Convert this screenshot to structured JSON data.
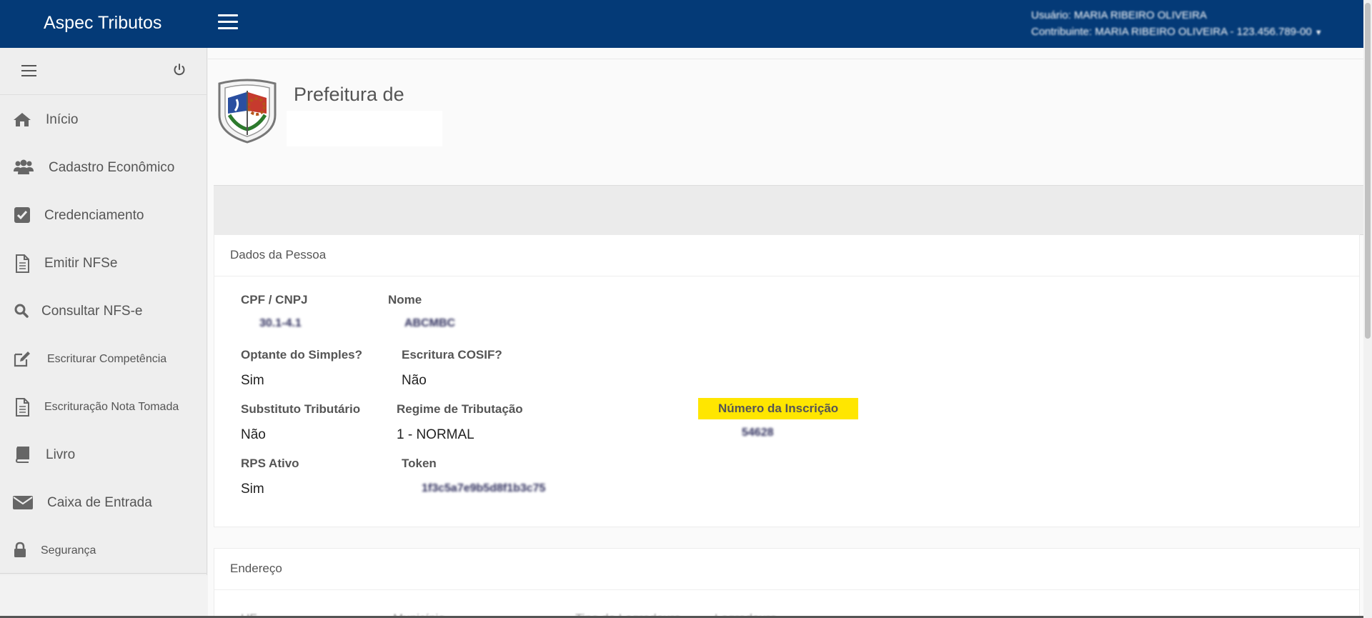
{
  "header": {
    "brand": "Aspec Tributos",
    "user_line1": "Usuário: MARIA RIBEIRO OLIVEIRA",
    "user_line2": "Contribuinte: MARIA RIBEIRO OLIVEIRA - 123.456.789-00"
  },
  "sidebar": {
    "items": [
      {
        "label": "Início",
        "icon": "home-icon"
      },
      {
        "label": "Cadastro Econômico",
        "icon": "users-icon"
      },
      {
        "label": "Credenciamento",
        "icon": "check-square-icon"
      },
      {
        "label": "Emitir NFSe",
        "icon": "document-icon"
      },
      {
        "label": "Consultar NFS-e",
        "icon": "search-icon"
      },
      {
        "label": "Escriturar Competência",
        "icon": "edit-icon"
      },
      {
        "label": "Escrituração Nota Tomada",
        "icon": "document-icon"
      },
      {
        "label": "Livro",
        "icon": "book-icon"
      },
      {
        "label": "Caixa de Entrada",
        "icon": "envelope-icon"
      },
      {
        "label": "Segurança",
        "icon": "lock-icon"
      }
    ]
  },
  "main": {
    "title": "Prefeitura de",
    "dados_panel": {
      "heading": "Dados da Pessoa",
      "cpf_label": "CPF / CNPJ",
      "cpf_value": "30.1-4.1",
      "nome_label": "Nome",
      "nome_value": "ABCMBC",
      "simples_label": "Optante do Simples?",
      "simples_value": "Sim",
      "cosif_label": "Escritura COSIF?",
      "cosif_value": "Não",
      "substituto_label": "Substituto Tributário",
      "substituto_value": "Não",
      "regime_label": "Regime de Tributação",
      "regime_value": "1 - NORMAL",
      "inscricao_label": "Número da Inscrição",
      "inscricao_value": "54628",
      "rps_label": "RPS Ativo",
      "rps_value": "Sim",
      "token_label": "Token",
      "token_value": "1f3c5a7e9b5d8f1b3c75"
    },
    "endereco_panel": {
      "heading": "Endereço",
      "partial_fields": [
        "UF",
        "Município",
        "Tipo de Logradouro",
        "Logradouro"
      ]
    }
  },
  "colors": {
    "topbar": "#043a77",
    "highlight": "#ffe600",
    "sidebar_bg": "#eeeeee"
  }
}
